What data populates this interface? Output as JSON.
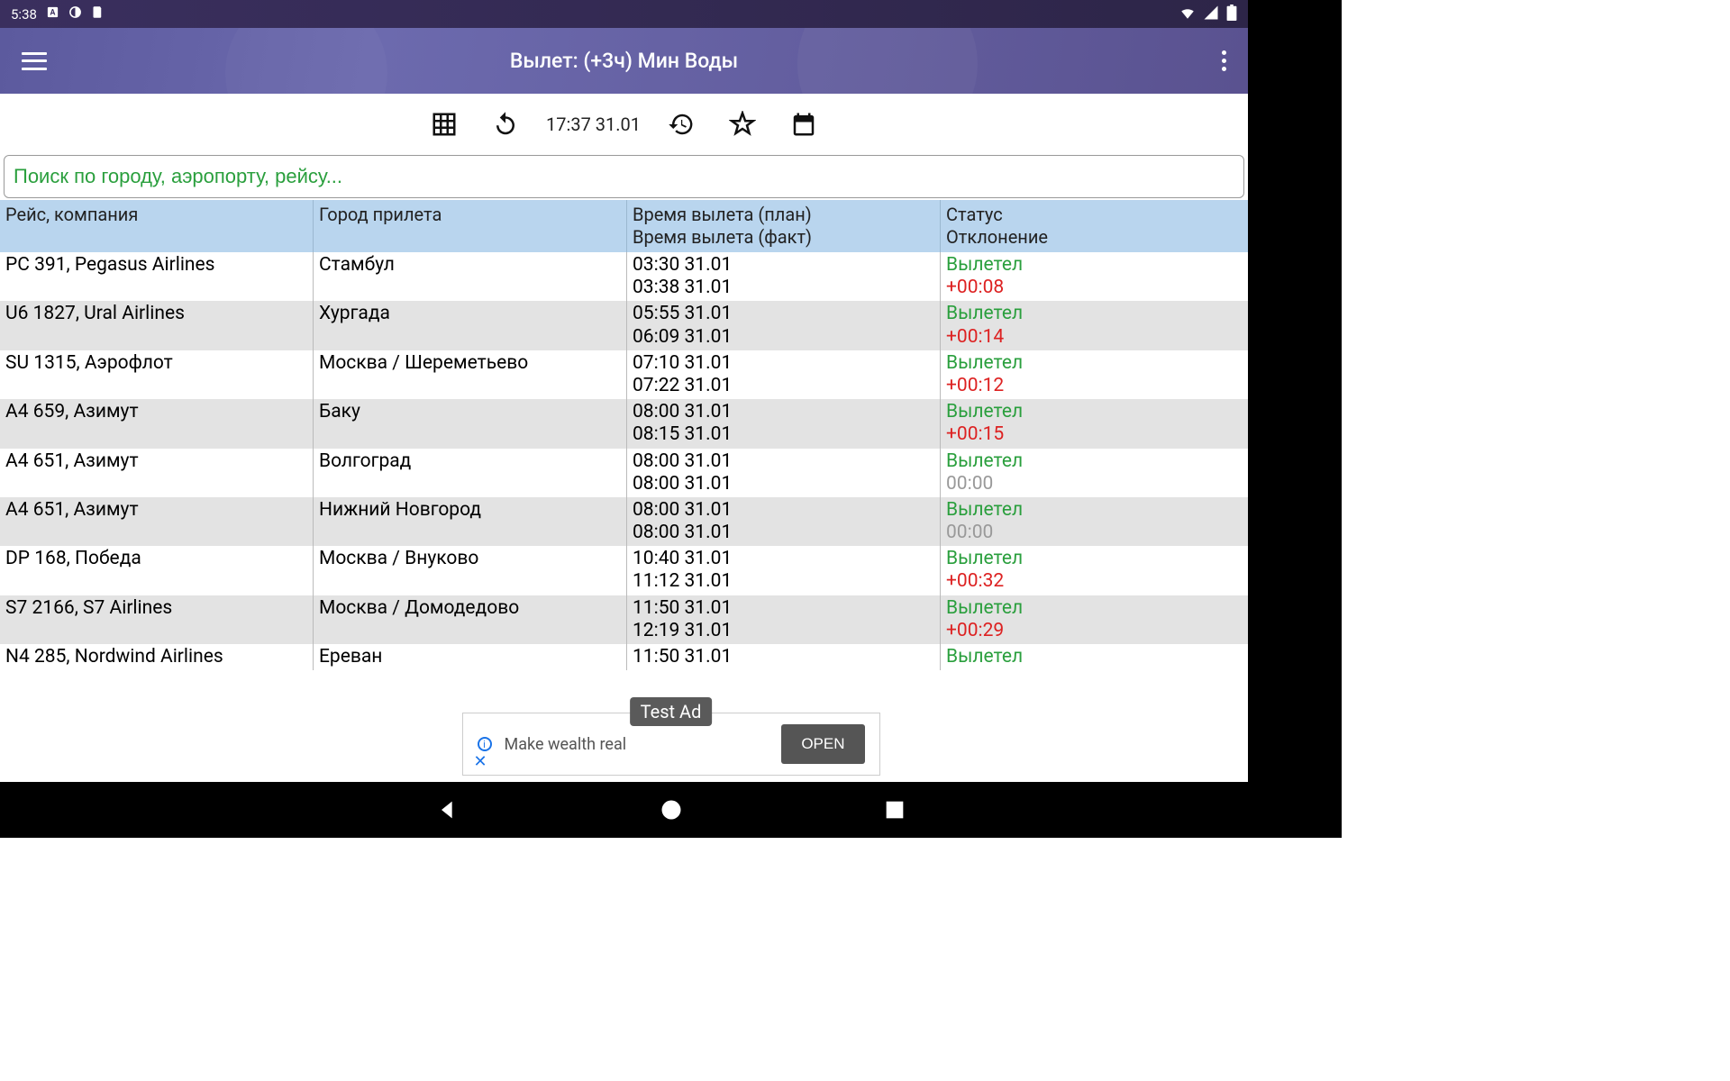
{
  "statusbar": {
    "time": "5:38"
  },
  "appbar": {
    "title": "Вылет: (+3ч) Мин Воды"
  },
  "toolbar": {
    "datetime": "17:37 31.01"
  },
  "search": {
    "placeholder": "Поиск по городу, аэропорту, рейсу..."
  },
  "headers": {
    "flight": "Рейс, компания",
    "dest": "Город прилета",
    "time1": "Время вылета (план)",
    "time2": "Время вылета (факт)",
    "status": "Статус",
    "dev": "Отклонение"
  },
  "rows": [
    {
      "flight": "PC 391, Pegasus Airlines",
      "dest": "Стамбул",
      "plan": "03:30 31.01",
      "fact": "03:38 31.01",
      "status": "Вылетел",
      "dev": "+00:08",
      "devcls": "dev-pos"
    },
    {
      "flight": "U6 1827, Ural Airlines",
      "dest": "Хургада",
      "plan": "05:55 31.01",
      "fact": "06:09 31.01",
      "status": "Вылетел",
      "dev": "+00:14",
      "devcls": "dev-pos"
    },
    {
      "flight": "SU 1315, Аэрофлот",
      "dest": "Москва / Шереметьево",
      "plan": "07:10 31.01",
      "fact": "07:22 31.01",
      "status": "Вылетел",
      "dev": "+00:12",
      "devcls": "dev-pos"
    },
    {
      "flight": "A4 659, Азимут",
      "dest": "Баку",
      "plan": "08:00 31.01",
      "fact": "08:15 31.01",
      "status": "Вылетел",
      "dev": "+00:15",
      "devcls": "dev-pos"
    },
    {
      "flight": "A4 651, Азимут",
      "dest": "Волгоград",
      "plan": "08:00 31.01",
      "fact": "08:00 31.01",
      "status": "Вылетел",
      "dev": "00:00",
      "devcls": "dev-zero"
    },
    {
      "flight": "A4 651, Азимут",
      "dest": "Нижний Новгород",
      "plan": "08:00 31.01",
      "fact": "08:00 31.01",
      "status": "Вылетел",
      "dev": "00:00",
      "devcls": "dev-zero"
    },
    {
      "flight": "DP 168, Победа",
      "dest": "Москва / Внуково",
      "plan": "10:40 31.01",
      "fact": "11:12 31.01",
      "status": "Вылетел",
      "dev": "+00:32",
      "devcls": "dev-pos"
    },
    {
      "flight": "S7 2166, S7 Airlines",
      "dest": "Москва / Домодедово",
      "plan": "11:50 31.01",
      "fact": "12:19 31.01",
      "status": "Вылетел",
      "dev": "+00:29",
      "devcls": "dev-pos"
    },
    {
      "flight": "N4 285, Nordwind Airlines",
      "dest": "Ереван",
      "plan": "11:50 31.01",
      "fact": "",
      "status": "Вылетел",
      "dev": "",
      "devcls": ""
    }
  ],
  "ad": {
    "badge": "Test Ad",
    "text": "Make wealth real",
    "button": "OPEN"
  }
}
